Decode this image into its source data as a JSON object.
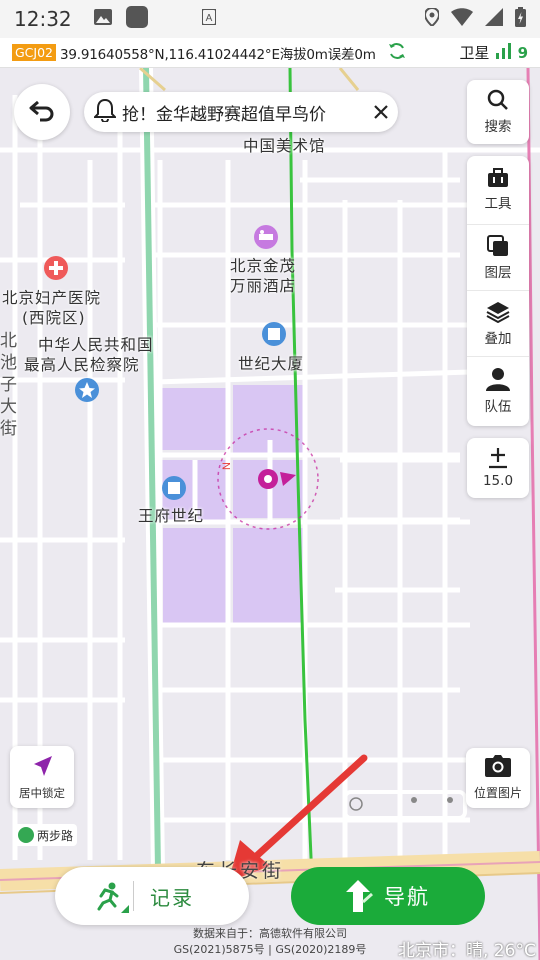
{
  "status_bar": {
    "time": "12:32",
    "icons_left": [
      "image-icon",
      "app-square-icon",
      "font-a-icon"
    ],
    "icons_right": [
      "location-pin-icon",
      "wifi-icon",
      "cell-signal-icon",
      "battery-icon"
    ]
  },
  "coord_bar": {
    "badge": "GCJ02",
    "coordinates": "39.91640558°N,116.41024442°E海拔0m误差0m",
    "satellite_label": "卫星",
    "satellite_count": "9",
    "accent": "#f39c12"
  },
  "banner": {
    "text": "抢！金华越野赛超值早鸟价"
  },
  "side_menu": {
    "search": "搜索",
    "tools": "工具",
    "layers": "图层",
    "overlay": "叠加",
    "team": "队伍",
    "zoom": "15.0"
  },
  "map": {
    "pois": {
      "museum": "中国美术馆",
      "hotel_line1": "北京金茂",
      "hotel_line2": "万丽酒店",
      "hospital_line1": "北京妇产医院",
      "hospital_line2": "(西院区)",
      "procuratorate_line1": "中华人民共和国",
      "procuratorate_line2": "最高人民检察院",
      "century_tower": "世纪大厦",
      "wangfu": "王府世纪"
    },
    "vertical_road": "北池子大街",
    "bottom_road": "东长安街",
    "compass_letter": "N"
  },
  "controls": {
    "locate": "居中锁定",
    "photo": "位置图片",
    "app_chip": "两步路",
    "record": "记录",
    "navigate": "导航"
  },
  "footer": {
    "source_line1": "数据来自于：高德软件有限公司",
    "source_line2": "GS(2021)5875号 | GS(2020)2189号",
    "weather": "北京市：晴, 26°C"
  },
  "colors": {
    "nav_green": "#1bab3a",
    "arrow_red": "#e53935",
    "marker_magenta": "#c41f9a",
    "highlight_purple": "#d9c6f3"
  }
}
